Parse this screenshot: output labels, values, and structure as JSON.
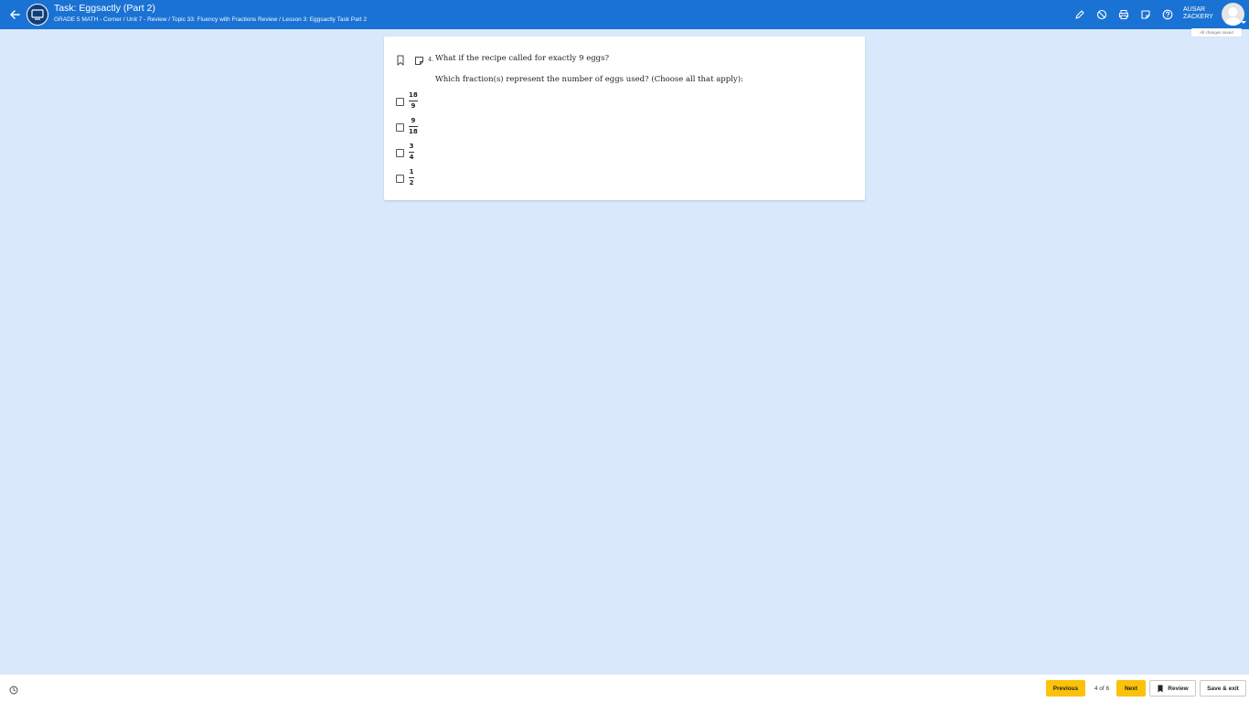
{
  "header": {
    "title": "Task: Eggsactly (Part 2)",
    "breadcrumb": "GRADE 5 MATH - Corner / Unit 7 - Review / Topic 33: Fluency with Fractions Review / Lesson 3: Eggsactly Task Part 2",
    "user_first": "AUSAR",
    "user_last": "ZACKERY",
    "saved_status": "All changes saved"
  },
  "question": {
    "number": "4.",
    "text": "What if the recipe called for exactly 9 eggs?",
    "prompt": "Which fraction(s) represent the number of eggs used? (Choose all that apply):",
    "choices": [
      {
        "numerator": "18",
        "denominator": "9"
      },
      {
        "numerator": "9",
        "denominator": "18"
      },
      {
        "numerator": "3",
        "denominator": "4"
      },
      {
        "numerator": "1",
        "denominator": "2"
      }
    ]
  },
  "footer": {
    "previous_label": "Previous",
    "page_indicator": "4 of 6",
    "next_label": "Next",
    "review_label": "Review",
    "save_exit_label": "Save & exit"
  },
  "colors": {
    "header_bg": "#1a73d4",
    "page_bg": "#d9e9fb",
    "accent_yellow": "#fcc10a"
  }
}
